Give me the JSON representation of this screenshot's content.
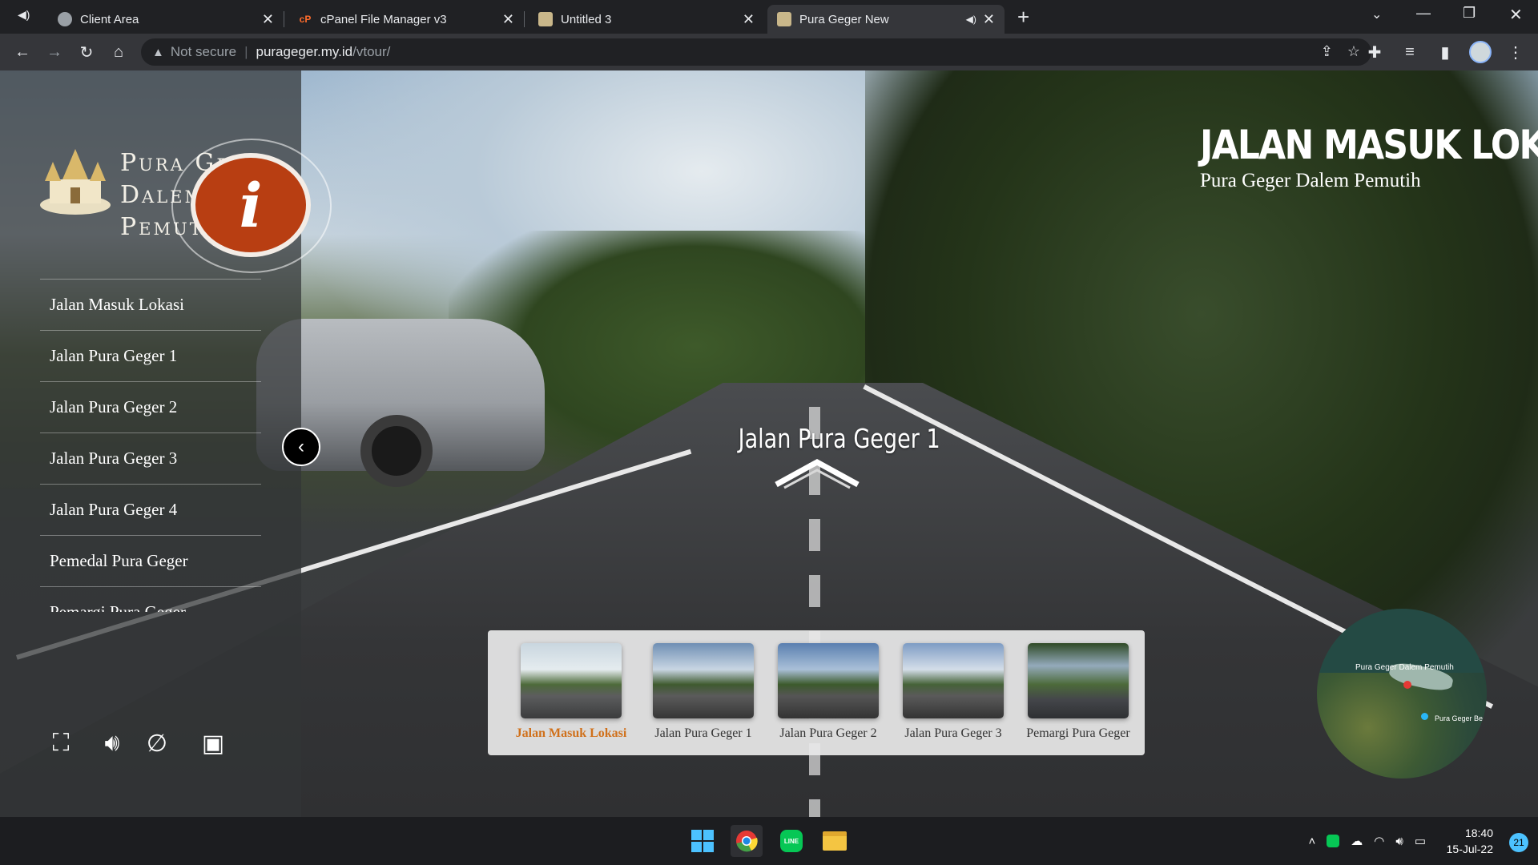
{
  "browser": {
    "tabs": [
      {
        "title": "Client Area",
        "active": false
      },
      {
        "title": "cPanel File Manager v3",
        "active": false
      },
      {
        "title": "Untitled 3",
        "active": false
      },
      {
        "title": "Pura Geger New",
        "active": true
      }
    ],
    "security_label": "Not secure",
    "url_host": "purageger.my.id",
    "url_path": "/vtour/"
  },
  "tour": {
    "logo_line1": "Pura Geger",
    "logo_line2": "Dalem Pemutih",
    "info_glyph": "i",
    "menu": [
      "Jalan Masuk Lokasi",
      "Jalan Pura Geger 1",
      "Jalan Pura Geger 2",
      "Jalan Pura Geger 3",
      "Jalan Pura Geger 4",
      "Pemedal Pura Geger",
      "Pemargi Pura Geger"
    ],
    "scene_title": "JALAN MASUK LOKASI",
    "scene_subtitle": "Pura Geger Dalem Pemutih",
    "hotspot_label": "Jalan Pura Geger 1",
    "thumbnails": [
      {
        "label": "Jalan Masuk Lokasi",
        "active": true
      },
      {
        "label": "Jalan Pura Geger 1",
        "active": false
      },
      {
        "label": "Jalan Pura Geger 2",
        "active": false
      },
      {
        "label": "Jalan Pura Geger 3",
        "active": false
      },
      {
        "label": "Pemargi Pura Geger",
        "active": false
      }
    ],
    "map_labels": [
      "Pura Geger Dalem Pemutih",
      "Pura Geger Bea"
    ],
    "controls": [
      "fullscreen-icon",
      "sound-icon",
      "gyro-off-icon",
      "gallery-icon"
    ],
    "accent_color": "#d0701a"
  },
  "taskbar": {
    "time": "18:40",
    "date": "15-Jul-22",
    "notifications": "21"
  }
}
